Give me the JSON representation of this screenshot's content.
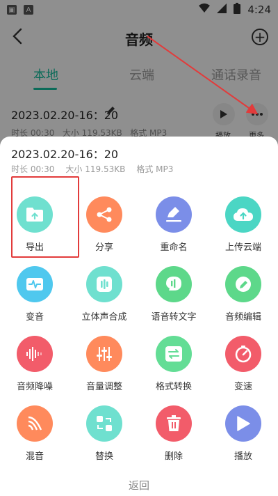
{
  "status_bar": {
    "time": "4:24",
    "app_icon_letter": "A"
  },
  "header": {
    "title": "音频"
  },
  "tabs": [
    {
      "label": "本地",
      "active": true
    },
    {
      "label": "云端",
      "active": false
    },
    {
      "label": "通话录音",
      "active": false
    }
  ],
  "record": {
    "name": "2023.02.20-16：20",
    "duration": "时长 00:30",
    "size": "大小 119.53KB",
    "format": "格式 MP3",
    "play_label": "播放",
    "more_label": "更多"
  },
  "sheet": {
    "title": "2023.02.20-16：20",
    "duration": "时长 00:30",
    "size": "大小 119.53KB",
    "format": "格式 MP3",
    "actions": [
      {
        "label": "导出",
        "icon": "export-folder-icon",
        "color": "#6fe0cf"
      },
      {
        "label": "分享",
        "icon": "share-icon",
        "color": "#ff8a5c"
      },
      {
        "label": "重命名",
        "icon": "rename-icon",
        "color": "#7b8ee8"
      },
      {
        "label": "上传云端",
        "icon": "cloud-upload-icon",
        "color": "#4bd6c4"
      },
      {
        "label": "变音",
        "icon": "voice-change-icon",
        "color": "#4fc8ee"
      },
      {
        "label": "立体声合成",
        "icon": "stereo-mix-icon",
        "color": "#6fe0cf"
      },
      {
        "label": "语音转文字",
        "icon": "speech-to-text-icon",
        "color": "#5dd88a"
      },
      {
        "label": "音频编辑",
        "icon": "audio-edit-icon",
        "color": "#5dd88a"
      },
      {
        "label": "音频降噪",
        "icon": "noise-reduction-icon",
        "color": "#f25c6a"
      },
      {
        "label": "音量调整",
        "icon": "volume-adjust-icon",
        "color": "#ff8a5c"
      },
      {
        "label": "格式转换",
        "icon": "format-convert-icon",
        "color": "#63dd95"
      },
      {
        "label": "变速",
        "icon": "speed-icon",
        "color": "#f25c6a"
      },
      {
        "label": "混音",
        "icon": "mix-icon",
        "color": "#ff8a5c"
      },
      {
        "label": "替换",
        "icon": "replace-icon",
        "color": "#6fe0cf"
      },
      {
        "label": "删除",
        "icon": "delete-icon",
        "color": "#f25c6a"
      },
      {
        "label": "播放",
        "icon": "play-icon",
        "color": "#7b8ee8"
      }
    ],
    "back_label": "返回"
  },
  "colors": {
    "accent": "#16b99a",
    "annotation": "#e23b3b"
  }
}
